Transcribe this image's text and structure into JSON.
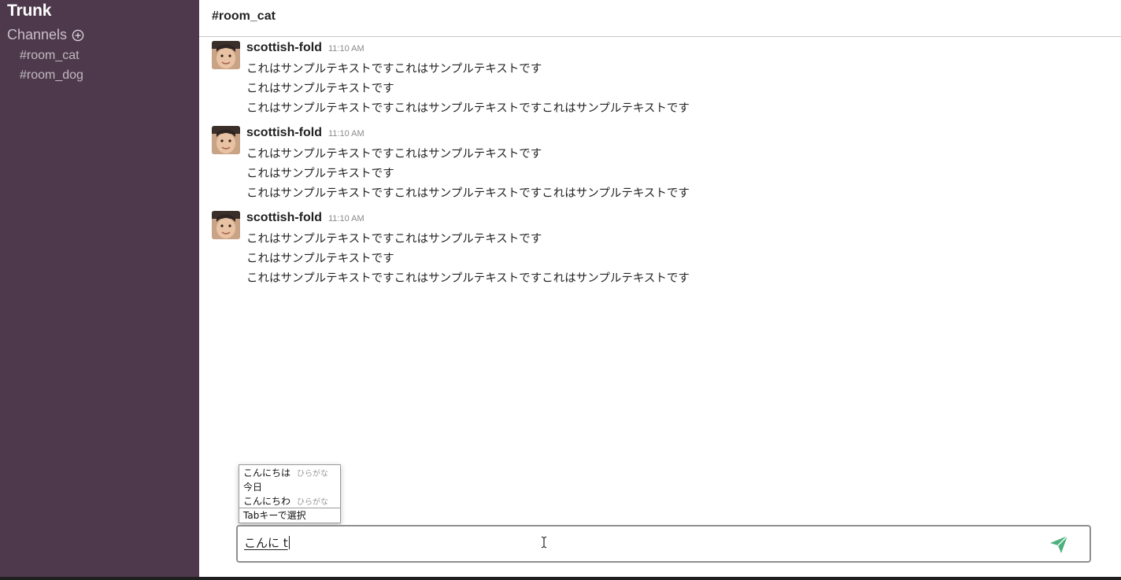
{
  "sidebar": {
    "team_name": "Trunk",
    "channels_label": "Channels",
    "add_icon": "plus-circle-icon",
    "channels": [
      "#room_cat",
      "#room_dog"
    ]
  },
  "header": {
    "channel_title": "#room_cat"
  },
  "messages": [
    {
      "username": "scottish-fold",
      "time": "11:10 AM",
      "lines": [
        "これはサンプルテキストですこれはサンプルテキストです",
        "これはサンプルテキストです",
        "これはサンプルテキストですこれはサンプルテキストですこれはサンプルテキストです"
      ]
    },
    {
      "username": "scottish-fold",
      "time": "11:10 AM",
      "lines": [
        "これはサンプルテキストですこれはサンプルテキストです",
        "これはサンプルテキストです",
        "これはサンプルテキストですこれはサンプルテキストですこれはサンプルテキストです"
      ]
    },
    {
      "username": "scottish-fold",
      "time": "11:10 AM",
      "lines": [
        "これはサンプルテキストですこれはサンプルテキストです",
        "これはサンプルテキストです",
        "これはサンプルテキストですこれはサンプルテキストですこれはサンプルテキストです"
      ]
    }
  ],
  "ime": {
    "candidates": [
      {
        "text": "こんにちは",
        "hint": "ひらがな"
      },
      {
        "text": "今日",
        "hint": ""
      },
      {
        "text": "こんにちわ",
        "hint": "ひらがな"
      }
    ],
    "footer": "Tabキーで選択"
  },
  "composer": {
    "value": "こんに t",
    "send_icon": "paper-plane-icon",
    "colors": {
      "send": "#4caf7d"
    }
  },
  "colors": {
    "sidebar_bg": "#4d394b",
    "sidebar_text": "#c2b8c0"
  }
}
